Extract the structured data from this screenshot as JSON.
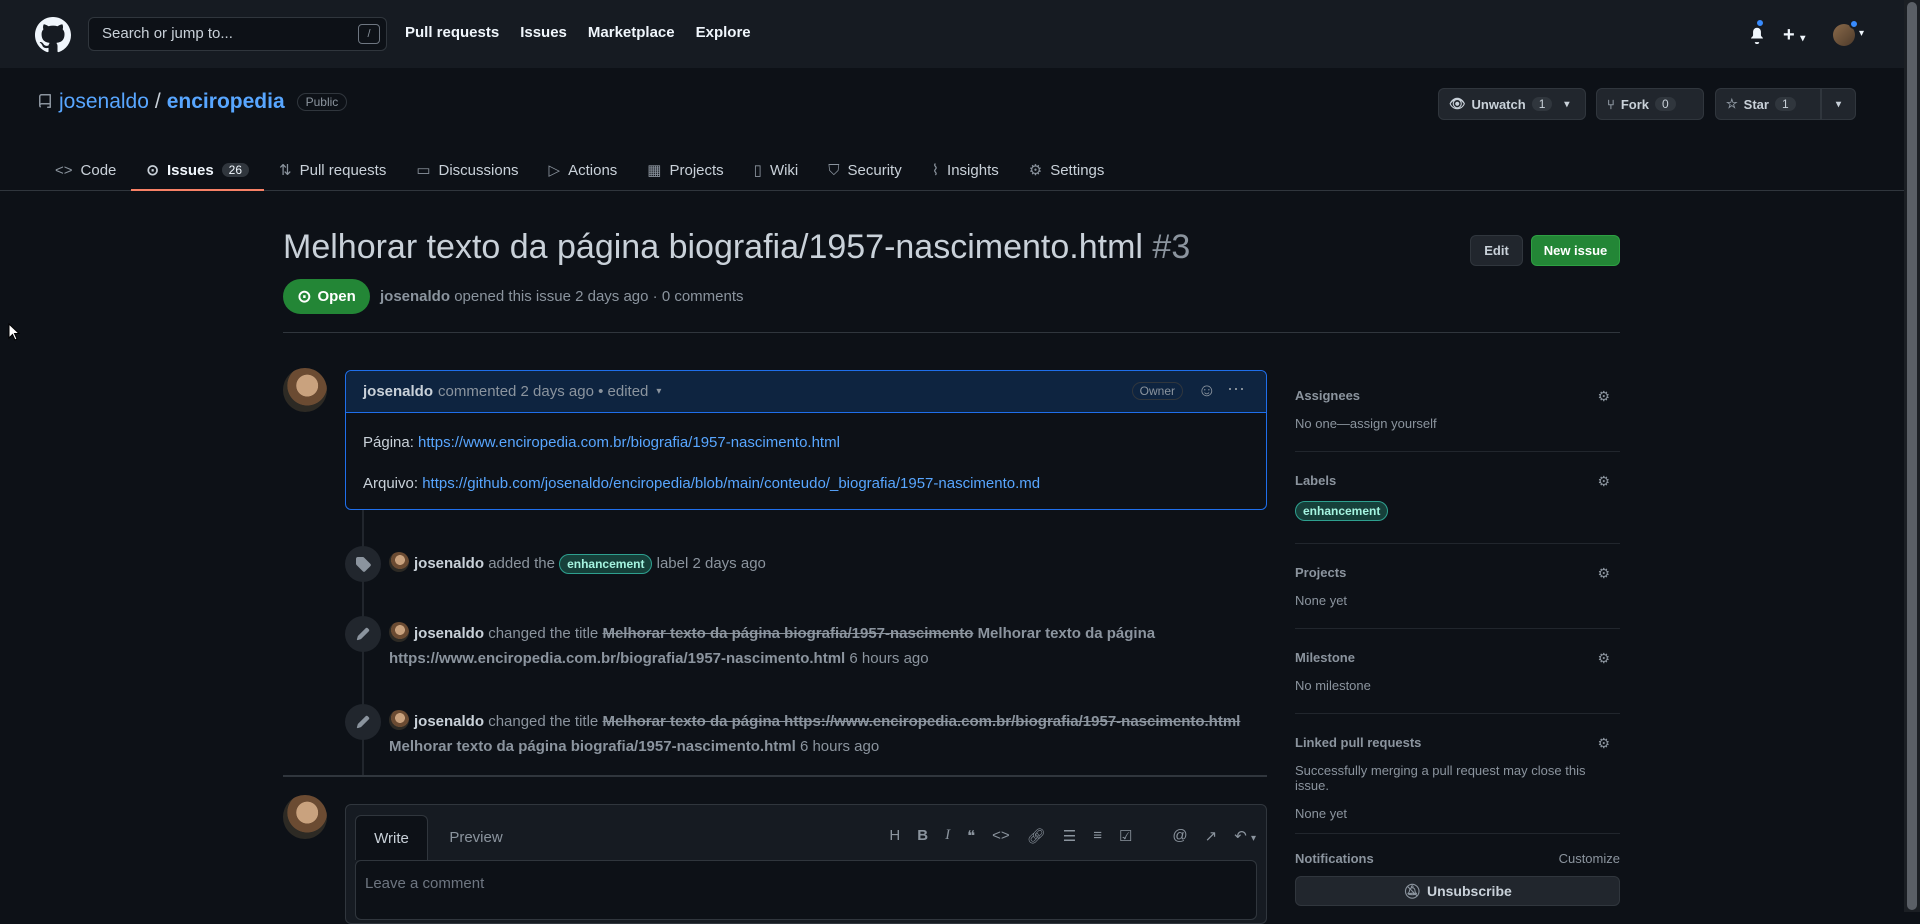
{
  "header": {
    "search_placeholder": "Search or jump to...",
    "search_key": "/",
    "nav": [
      "Pull requests",
      "Issues",
      "Marketplace",
      "Explore"
    ]
  },
  "repo": {
    "owner": "josenaldo",
    "separator": "/",
    "name": "enciropedia",
    "visibility": "Public",
    "watch_label": "Unwatch",
    "watch_count": "1",
    "fork_label": "Fork",
    "fork_count": "0",
    "star_label": "Star",
    "star_count": "1"
  },
  "tabs": [
    {
      "label": "Code",
      "icon": "code-icon"
    },
    {
      "label": "Issues",
      "icon": "issue-opened-icon",
      "count": "26",
      "active": true
    },
    {
      "label": "Pull requests",
      "icon": "git-pull-request-icon"
    },
    {
      "label": "Discussions",
      "icon": "comment-discussion-icon"
    },
    {
      "label": "Actions",
      "icon": "play-icon"
    },
    {
      "label": "Projects",
      "icon": "table-icon"
    },
    {
      "label": "Wiki",
      "icon": "book-icon"
    },
    {
      "label": "Security",
      "icon": "shield-icon"
    },
    {
      "label": "Insights",
      "icon": "graph-icon"
    },
    {
      "label": "Settings",
      "icon": "gear-icon"
    }
  ],
  "issue": {
    "title": "Melhorar texto da página biografia/1957-nascimento.html",
    "number": "#3",
    "edit_label": "Edit",
    "new_issue_label": "New issue",
    "state": "Open",
    "author": "josenaldo",
    "meta_text": "opened this issue 2 days ago · 0 comments"
  },
  "comment": {
    "author": "josenaldo",
    "meta": "commented 2 days ago • edited",
    "role": "Owner",
    "line1_label": "Página:",
    "line1_link": "https://www.enciropedia.com.br/biografia/1957-nascimento.html",
    "line2_label": "Arquivo:",
    "line2_link": "https://github.com/josenaldo/enciropedia/blob/main/conteudo/_biografia/1957-nascimento.md"
  },
  "events": [
    {
      "icon": "tag-icon",
      "author": "josenaldo",
      "pre": "added the",
      "label": "enhancement",
      "post": "label 2 days ago"
    },
    {
      "icon": "pencil-icon",
      "author": "josenaldo",
      "pre": "changed the title",
      "old": "Melhorar texto da página biografia/1957-nascimento",
      "new1": "Melhorar texto da página",
      "new2": "https://www.enciropedia.com.br/biografia/1957-nascimento.html",
      "time": "6 hours ago"
    },
    {
      "icon": "pencil-icon",
      "author": "josenaldo",
      "pre": "changed the title",
      "old": "Melhorar texto da página https://www.enciropedia.com.br/biografia/1957-nascimento.html",
      "new": "Melhorar texto da página biografia/1957-nascimento.html",
      "time": "6 hours ago"
    }
  ],
  "composer": {
    "write_tab": "Write",
    "preview_tab": "Preview",
    "placeholder": "Leave a comment"
  },
  "sidebar": {
    "assignees_title": "Assignees",
    "assignees_value": "No one—assign yourself",
    "labels_title": "Labels",
    "labels_value": "enhancement",
    "projects_title": "Projects",
    "projects_value": "None yet",
    "milestone_title": "Milestone",
    "milestone_value": "No milestone",
    "linked_title": "Linked pull requests",
    "linked_desc": "Successfully merging a pull request may close this issue.",
    "linked_value": "None yet",
    "notifications_title": "Notifications",
    "customize_label": "Customize",
    "unsubscribe_label": "Unsubscribe"
  },
  "colors": {
    "background": "#0d1117",
    "header": "#161b22",
    "link": "#58a6ff",
    "open_green": "#238636",
    "tab_underline": "#f78166"
  }
}
